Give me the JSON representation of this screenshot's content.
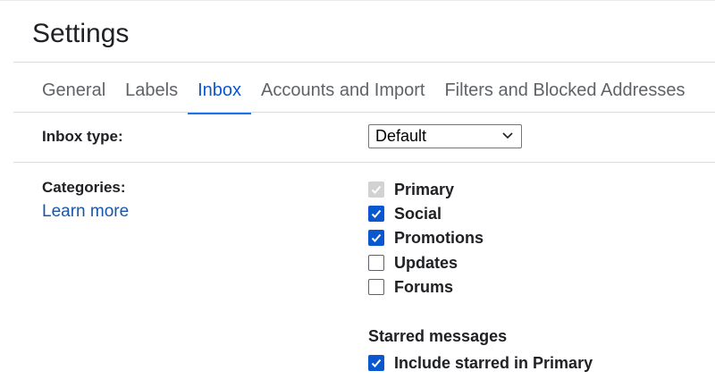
{
  "page": {
    "title": "Settings"
  },
  "tabs": [
    {
      "label": "General",
      "active": false
    },
    {
      "label": "Labels",
      "active": false
    },
    {
      "label": "Inbox",
      "active": true
    },
    {
      "label": "Accounts and Import",
      "active": false
    },
    {
      "label": "Filters and Blocked Addresses",
      "active": false
    }
  ],
  "inbox_type": {
    "label": "Inbox type:",
    "selected": "Default",
    "icon": "chevron-down-icon"
  },
  "categories": {
    "label": "Categories:",
    "learn_more": "Learn more",
    "items": [
      {
        "label": "Primary",
        "checked": true,
        "disabled": true
      },
      {
        "label": "Social",
        "checked": true,
        "disabled": false
      },
      {
        "label": "Promotions",
        "checked": true,
        "disabled": false
      },
      {
        "label": "Updates",
        "checked": false,
        "disabled": false
      },
      {
        "label": "Forums",
        "checked": false,
        "disabled": false
      }
    ]
  },
  "starred": {
    "heading": "Starred messages",
    "option": {
      "label": "Include starred in Primary",
      "checked": true
    }
  },
  "colors": {
    "accent": "#1a73e8",
    "checkbox": "#0b57d0",
    "link": "#1a56a8",
    "text": "#202124",
    "muted": "#5f6368"
  }
}
